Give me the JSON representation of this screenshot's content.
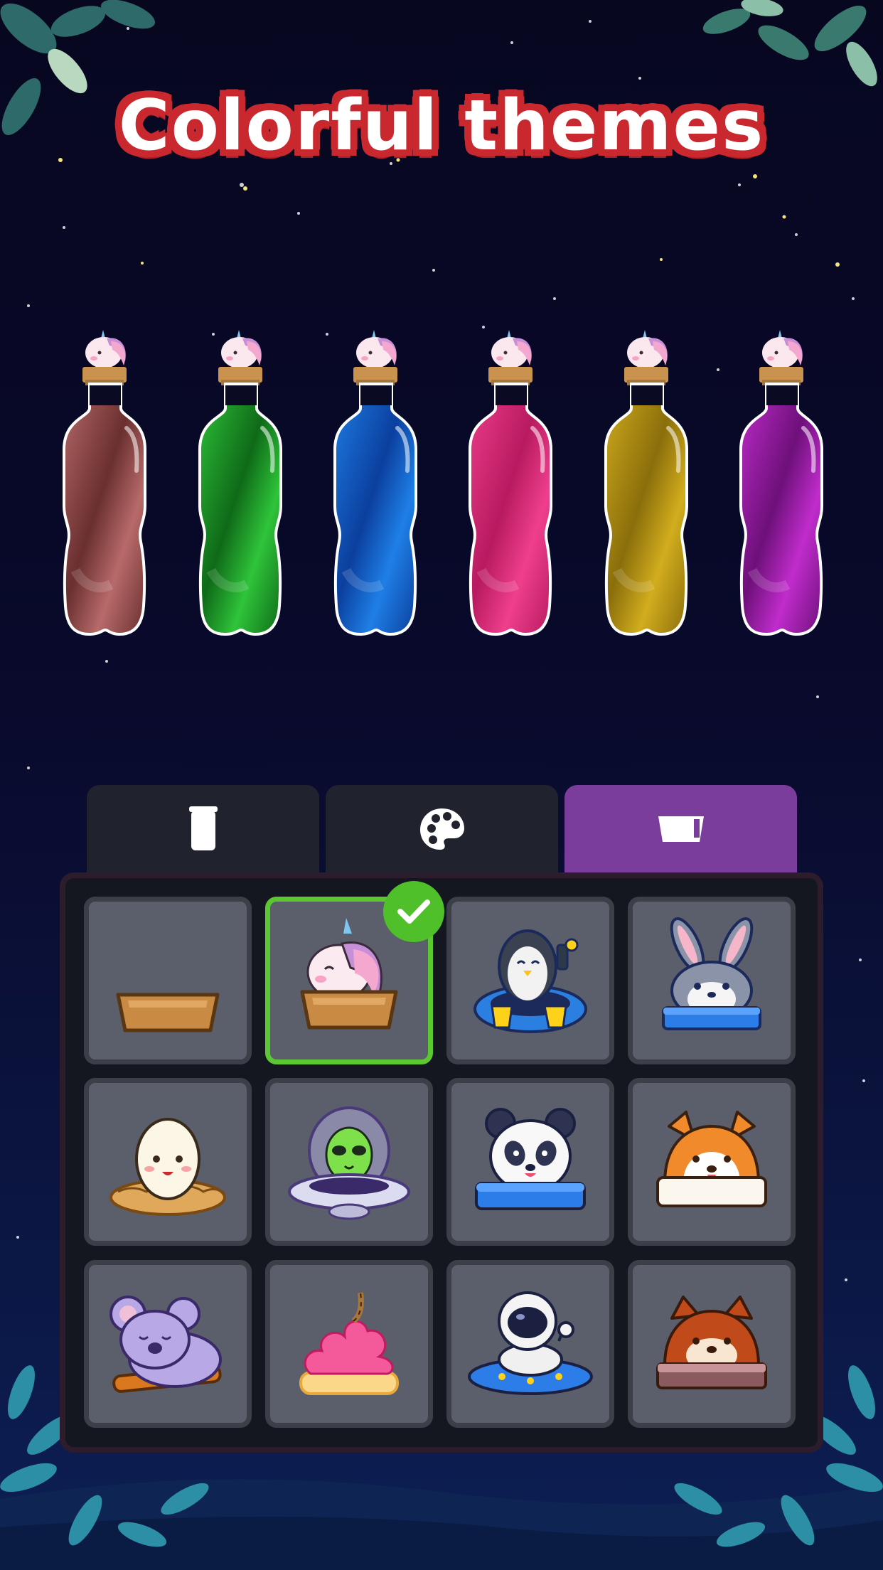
{
  "title": "Colorful themes",
  "bottles": [
    {
      "color": "#b86a6a",
      "dark": "#6a2f2f"
    },
    {
      "color": "#2fc43a",
      "dark": "#0f6a18"
    },
    {
      "color": "#1f7fe6",
      "dark": "#0b3f9e"
    },
    {
      "color": "#ef3f8c",
      "dark": "#b81a60"
    },
    {
      "color": "#d2ad1e",
      "dark": "#8a6e0b"
    },
    {
      "color": "#c02ccc",
      "dark": "#6e107a"
    }
  ],
  "tabs": [
    {
      "name": "bottle-tab",
      "icon": "bottle-icon",
      "active": false
    },
    {
      "name": "palette-tab",
      "icon": "palette-icon",
      "active": false
    },
    {
      "name": "base-tab",
      "icon": "base-icon",
      "active": true
    }
  ],
  "items": [
    {
      "name": "plain-wood-base",
      "icon": "wood-tray-icon",
      "selected": false
    },
    {
      "name": "unicorn-base",
      "icon": "unicorn-icon",
      "selected": true
    },
    {
      "name": "penguin-base",
      "icon": "penguin-icon",
      "selected": false
    },
    {
      "name": "bunny-base",
      "icon": "bunny-icon",
      "selected": false
    },
    {
      "name": "egg-base",
      "icon": "egg-nest-icon",
      "selected": false
    },
    {
      "name": "alien-base",
      "icon": "alien-ufo-icon",
      "selected": false
    },
    {
      "name": "panda-base",
      "icon": "panda-icon",
      "selected": false
    },
    {
      "name": "shiba-base",
      "icon": "shiba-icon",
      "selected": false
    },
    {
      "name": "koala-base",
      "icon": "koala-icon",
      "selected": false
    },
    {
      "name": "cupcake-base",
      "icon": "ice-cream-icon",
      "selected": false
    },
    {
      "name": "astronaut-base",
      "icon": "astronaut-ufo-icon",
      "selected": false
    },
    {
      "name": "bear-base",
      "icon": "red-panda-icon",
      "selected": false
    }
  ],
  "colors": {
    "accent_tab": "#7a3d9c",
    "selected_border": "#5bc832",
    "check_badge": "#4fbf2a",
    "title_outline": "#c8282e"
  }
}
